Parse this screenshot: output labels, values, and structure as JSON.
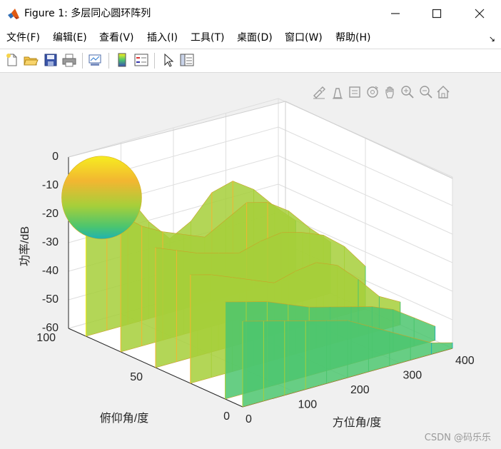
{
  "window": {
    "title": "Figure 1: 多层同心圆环阵列",
    "minimize_icon": "minimize-icon",
    "maximize_icon": "maximize-icon",
    "close_icon": "close-icon"
  },
  "menu": {
    "items": [
      "文件(F)",
      "编辑(E)",
      "查看(V)",
      "插入(I)",
      "工具(T)",
      "桌面(D)",
      "窗口(W)",
      "帮助(H)"
    ],
    "dock_icon": "dock-arrow-icon"
  },
  "toolbar": {
    "icons": [
      "new-figure-icon",
      "open-file-icon",
      "save-icon",
      "print-icon",
      "link-plot-icon",
      "colorbar-icon",
      "legend-icon",
      "pointer-icon",
      "property-inspector-icon"
    ]
  },
  "axes_toolbar": {
    "icons": [
      "brush-icon",
      "data-tips-icon",
      "data-cursor-icon",
      "rotate-3d-icon",
      "pan-icon",
      "zoom-in-icon",
      "zoom-out-icon",
      "home-icon"
    ]
  },
  "chart_data": {
    "type": "surface",
    "title": "",
    "xlabel": "方位角/度",
    "ylabel": "俯仰角/度",
    "zlabel": "功率/dB",
    "xlim": [
      0,
      400
    ],
    "ylim": [
      0,
      100
    ],
    "zlim": [
      -60,
      0
    ],
    "x_ticks": [
      "0",
      "100",
      "200",
      "300",
      "400"
    ],
    "y_ticks": [
      "0",
      "50",
      "100"
    ],
    "z_ticks": [
      "0",
      "-10",
      "-20",
      "-30",
      "-40",
      "-50",
      "-60"
    ],
    "grid": true,
    "colormap": [
      "#1fb3b0",
      "#4cc56e",
      "#a6cf3a",
      "#f2b631",
      "#f9f11b"
    ],
    "peak": {
      "azimuth": 0,
      "elevation": 90,
      "power": 0
    },
    "surface_rows": [
      {
        "elevation": 90,
        "power": [
          0,
          -8,
          -15,
          -26,
          -34,
          -30,
          -22,
          -20,
          -25,
          -33,
          -40
        ]
      },
      {
        "elevation": 70,
        "power": [
          -12,
          -18,
          -22,
          -25,
          -28,
          -24,
          -20,
          -22,
          -27,
          -35,
          -42
        ]
      },
      {
        "elevation": 50,
        "power": [
          -18,
          -21,
          -24,
          -26,
          -28,
          -26,
          -25,
          -27,
          -30,
          -36,
          -45
        ]
      },
      {
        "elevation": 30,
        "power": [
          -22,
          -24,
          -27,
          -30,
          -33,
          -31,
          -30,
          -33,
          -40,
          -48,
          -52
        ]
      },
      {
        "elevation": 10,
        "power": [
          -26,
          -28,
          -30,
          -33,
          -36,
          -38,
          -40,
          -42,
          -45,
          -50,
          -55
        ]
      },
      {
        "elevation": 0,
        "power": [
          -30,
          -32,
          -34,
          -36,
          -38,
          -40,
          -44,
          -48,
          -52,
          -56,
          -58
        ]
      }
    ]
  },
  "watermark": "CSDN @码乐乐"
}
